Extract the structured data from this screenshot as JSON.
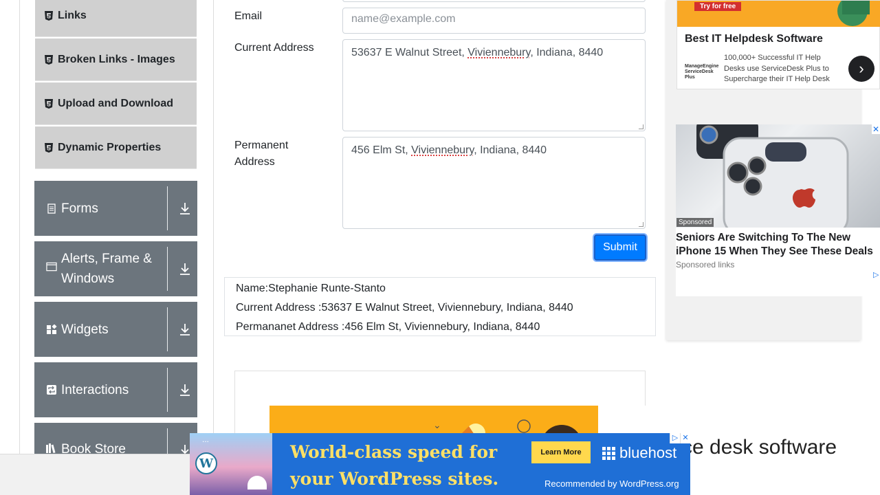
{
  "sidebar": {
    "sub_items": [
      {
        "label": "Links",
        "icon": "html5-icon"
      },
      {
        "label": "Broken Links - Images",
        "icon": "html5-icon"
      },
      {
        "label": "Upload and Download",
        "icon": "html5-icon"
      },
      {
        "label": "Dynamic Properties",
        "icon": "html5-icon"
      }
    ],
    "groups": [
      {
        "label": "Forms",
        "icon": "document-icon"
      },
      {
        "label": "Alerts, Frame & Windows",
        "icon": "window-icon"
      },
      {
        "label": "Widgets",
        "icon": "widgets-icon"
      },
      {
        "label": "Interactions",
        "icon": "interactions-icon"
      },
      {
        "label": "Book Store Application",
        "icon": "books-icon"
      }
    ]
  },
  "form": {
    "email_label": "Email",
    "email_placeholder": "name@example.com",
    "current_address_label": "Current Address",
    "current_address_parts": [
      "53637 E Walnut Street, ",
      "Viviennebury",
      ", Indiana, 8440"
    ],
    "permanent_address_label_line1": "Permanent",
    "permanent_address_label_line2": "Address",
    "permanent_address_parts": [
      "456 Elm St, ",
      "Viviennebury",
      ", Indiana, 8440"
    ],
    "submit_label": "Submit"
  },
  "output": {
    "name": "Name:Stephanie Runte-Stanto",
    "current_address": "Current Address :53637 E Walnut Street, Viviennebury, Indiana, 8440",
    "permanent_address": "Permananet Address :456 Elm St, Viviennebury, Indiana, 8440"
  },
  "ads": {
    "helpdesk": {
      "badge": "Try for free",
      "title": "Best IT Helpdesk Software",
      "logo_text": "ManageEngine ServiceDesk Plus",
      "description": "100,000+ Successful IT Help Desks use ServiceDesk Plus to Supercharge their IT Help Desk"
    },
    "iphone": {
      "sponsored": "Sponsored",
      "headline": "Seniors Are Switching To The New iPhone 15 When They See These Deals",
      "links": "Sponsored links"
    },
    "service_desk_banner": {
      "headline": "ce desk software"
    },
    "bluehost": {
      "headline_line1": "World-class speed for",
      "headline_line2": "your WordPress sites.",
      "button": "Learn More",
      "brand": "bluehost",
      "footer": "Recommended by WordPress.org",
      "wp_logo": "W",
      "dots": "..."
    }
  }
}
